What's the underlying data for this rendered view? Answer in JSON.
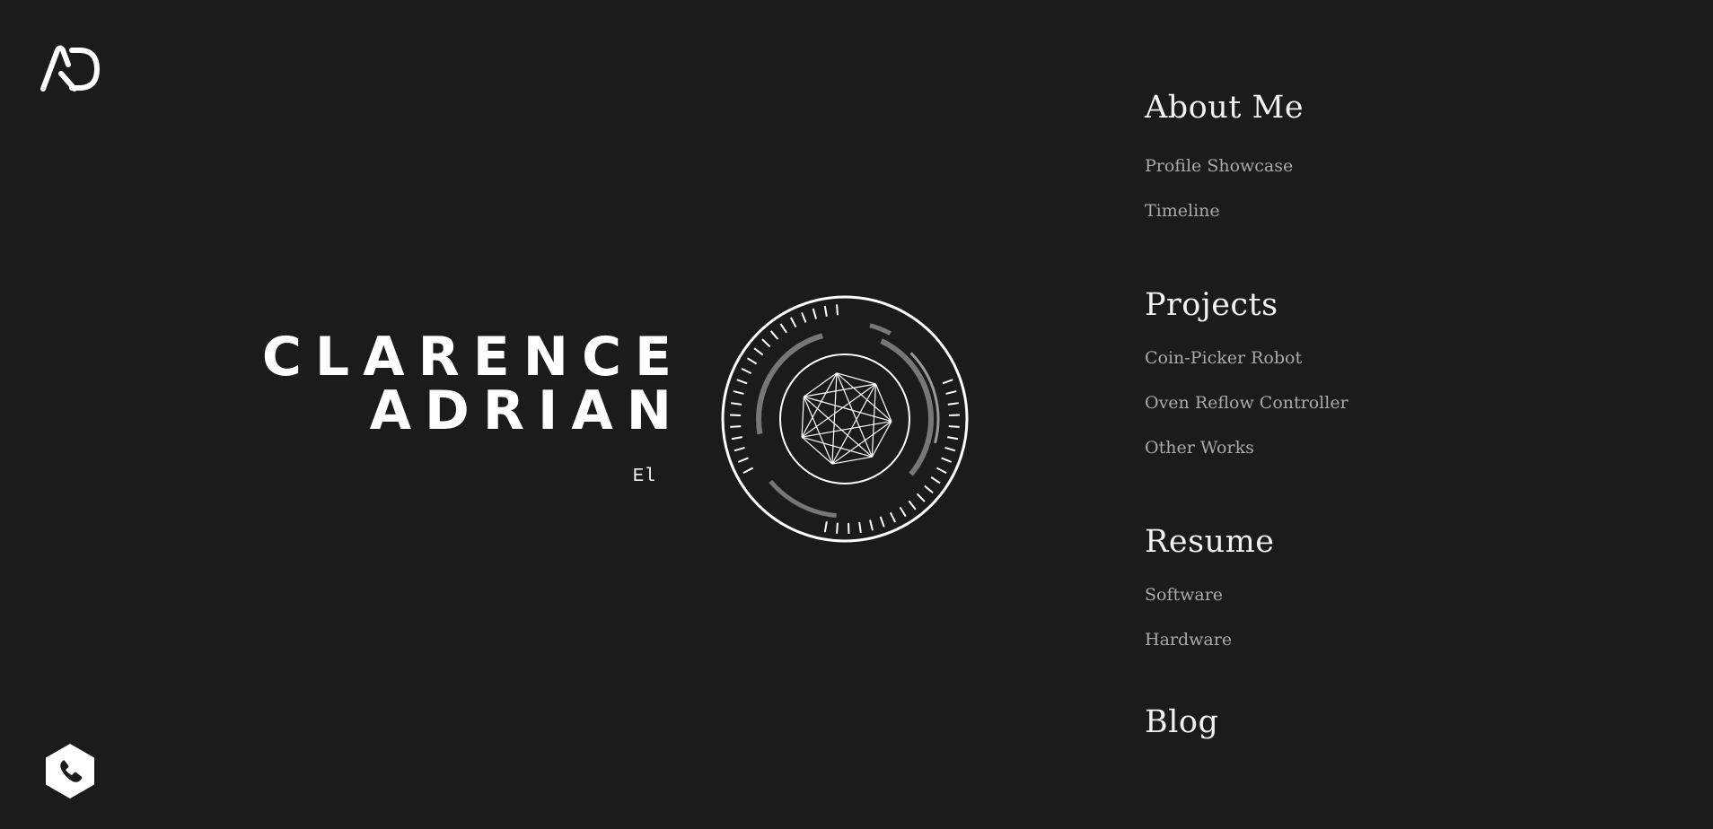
{
  "brand": {
    "logo_icon": "ad-monogram-logo"
  },
  "hero": {
    "first_name": "CLARENCE",
    "last_name": "ADRIAN",
    "subtitle": "El",
    "emblem_icon": "circular-hud-emblem"
  },
  "nav": {
    "about": {
      "heading": "About Me",
      "links": [
        "Profile Showcase",
        "Timeline"
      ]
    },
    "projects": {
      "heading": "Projects",
      "links": [
        "Coin-Picker Robot",
        "Oven Reflow Controller",
        "Other Works"
      ]
    },
    "resume": {
      "heading": "Resume",
      "links": [
        "Software",
        "Hardware"
      ]
    },
    "blog": {
      "heading": "Blog"
    }
  },
  "contact": {
    "icon": "phone-icon"
  },
  "colors": {
    "background": "#1b1b1b",
    "heading": "#f2f2f2",
    "link": "#a9a9a9",
    "accent_gray": "#777777"
  }
}
